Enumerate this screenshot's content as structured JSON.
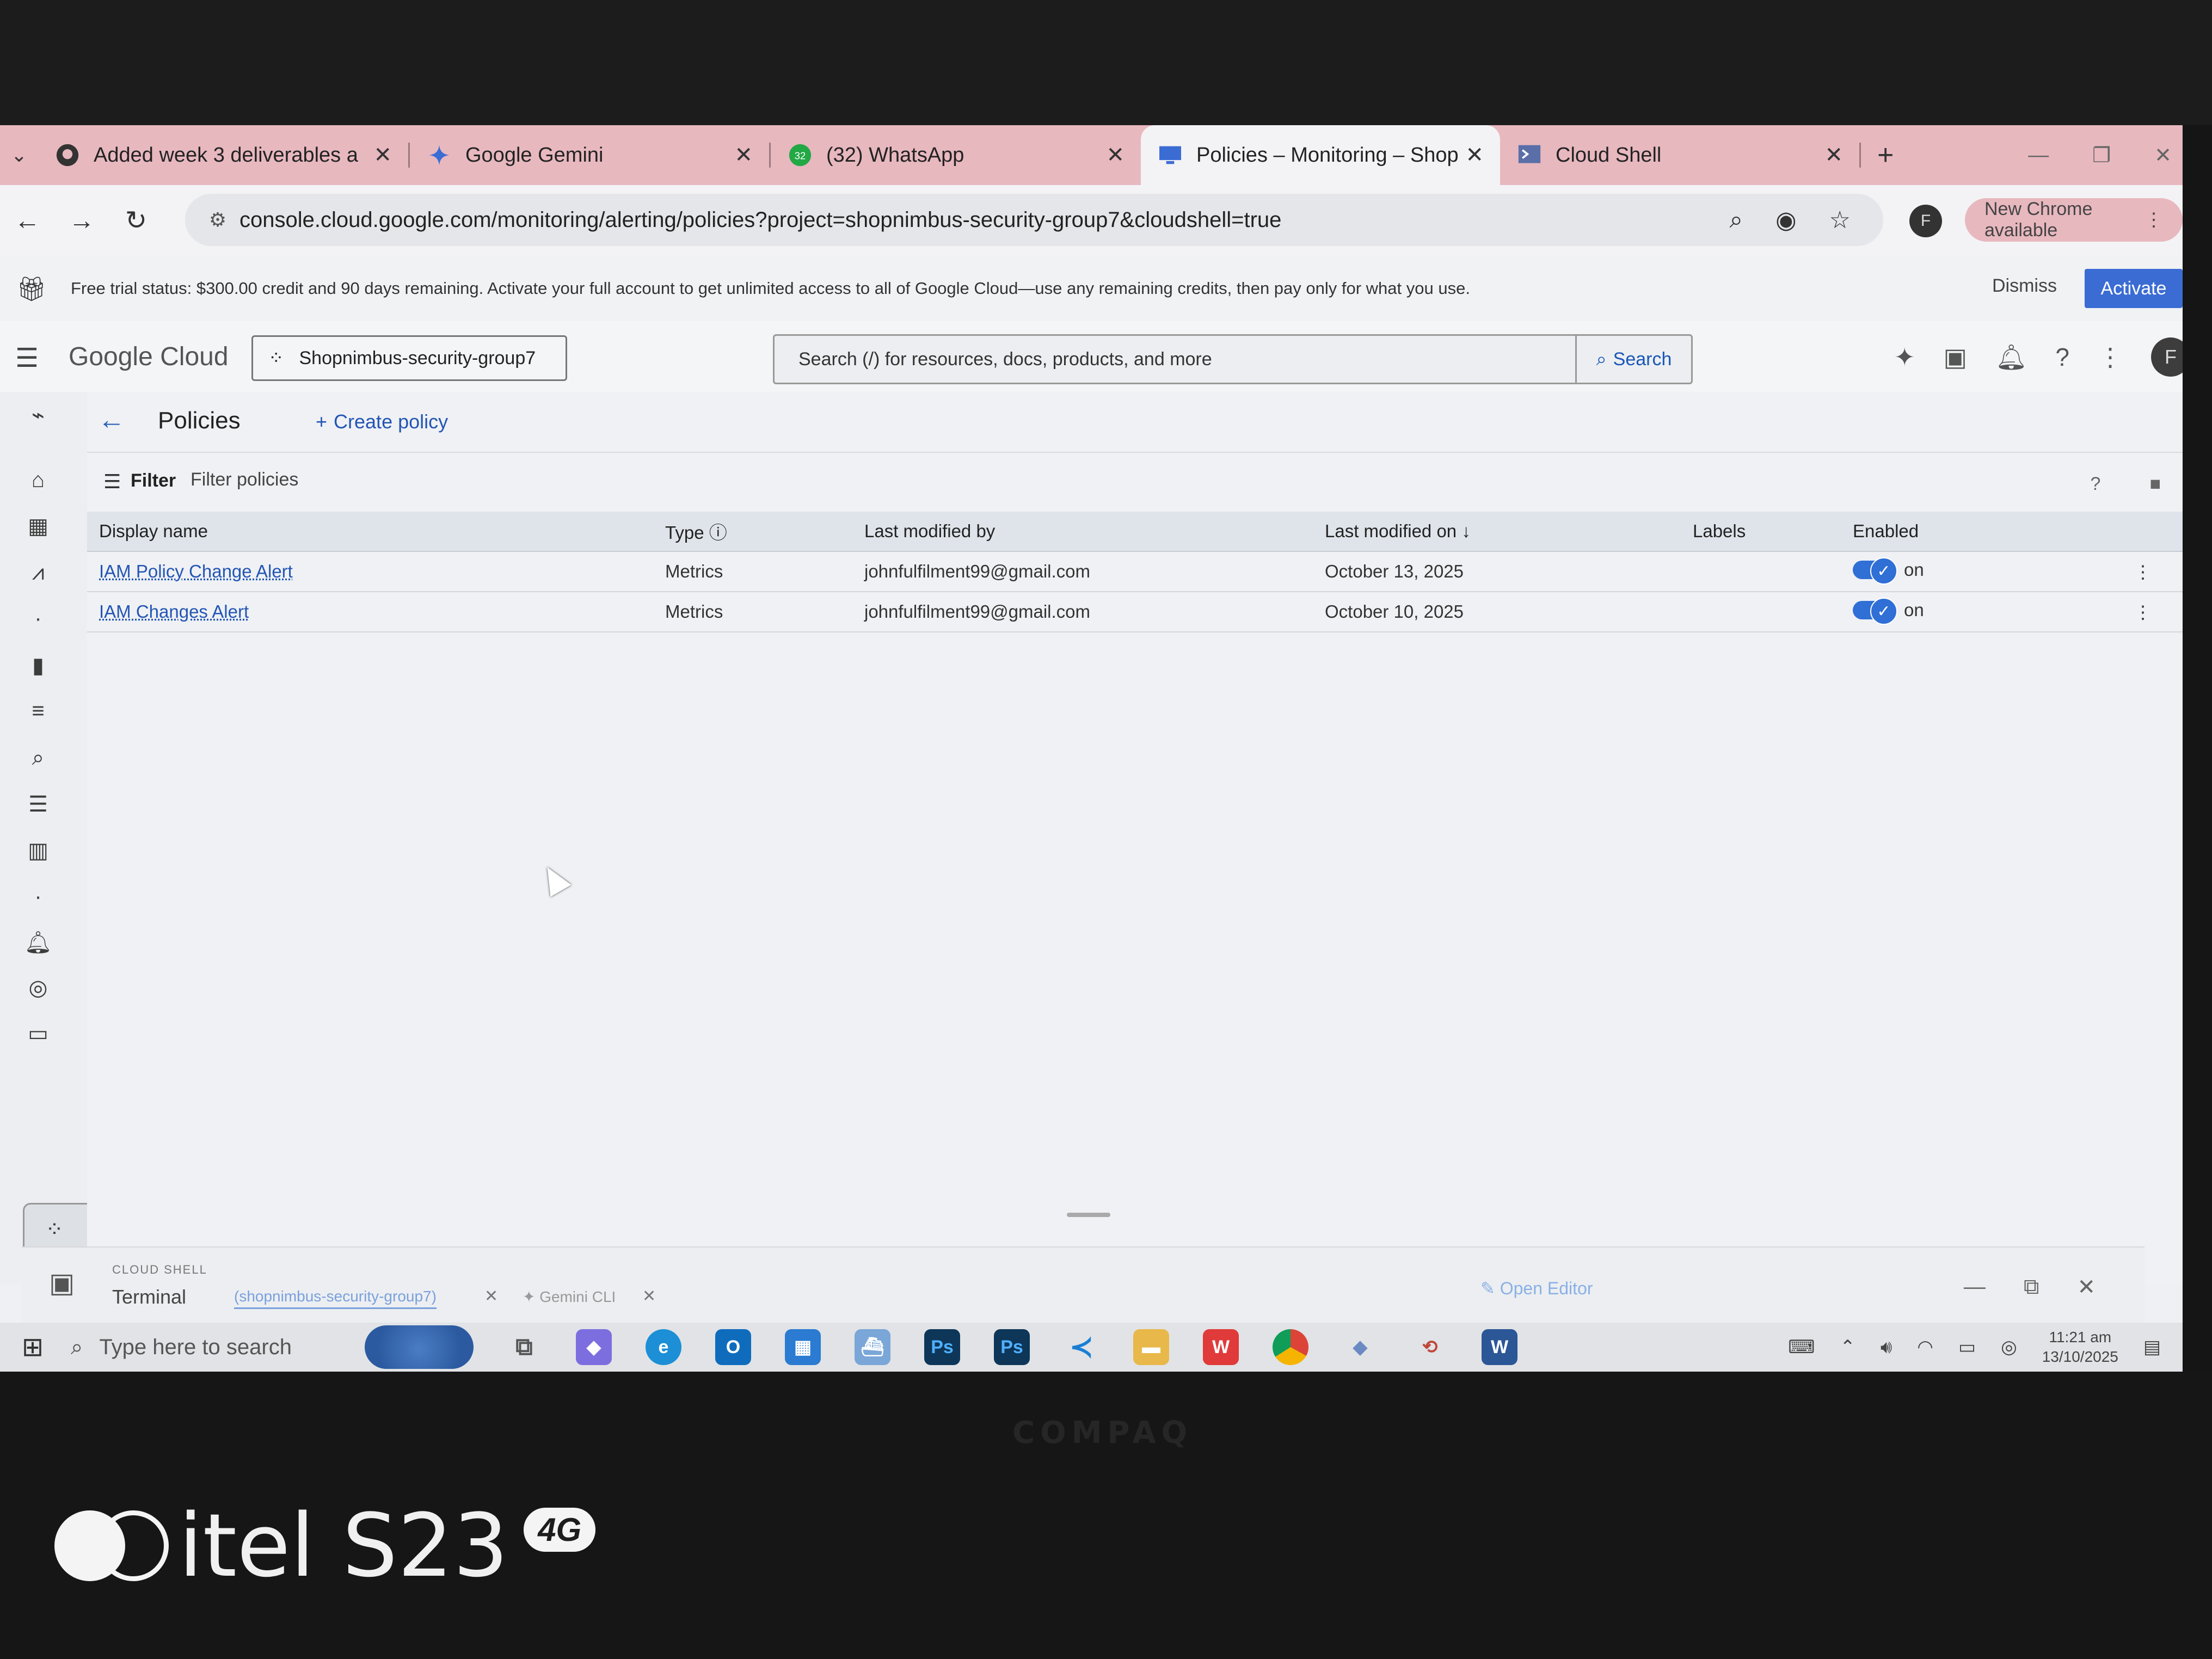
{
  "browser": {
    "tabs": [
      {
        "title": "Added week 3 deliverables a",
        "icon": "github-icon",
        "active": false
      },
      {
        "title": "Google Gemini",
        "icon": "gemini-icon",
        "active": false
      },
      {
        "title": "(32) WhatsApp",
        "icon": "whatsapp-icon",
        "active": false,
        "badge": "32"
      },
      {
        "title": "Policies – Monitoring – Shop",
        "icon": "monitoring-icon",
        "active": true
      },
      {
        "title": "Cloud Shell",
        "icon": "cloud-shell-icon",
        "active": false
      }
    ],
    "url": "console.cloud.google.com/monitoring/alerting/policies?project=shopnimbus-security-group7&cloudshell=true",
    "profile_initial": "F",
    "update_label": "New Chrome available"
  },
  "banner": {
    "text": "Free trial status: $300.00 credit and 90 days remaining. Activate your full account to get unlimited access to all of Google Cloud—use any remaining credits, then pay only for what you use.",
    "dismiss_label": "Dismiss",
    "activate_label": "Activate"
  },
  "header": {
    "logo_google": "Google",
    "logo_cloud": "Cloud",
    "project": "Shopnimbus-security-group7",
    "search_placeholder": "Search (/) for resources, docs, products, and more",
    "search_button": "Search",
    "avatar_initial": "F"
  },
  "page": {
    "title": "Policies",
    "create_label": "Create policy",
    "filter_label": "Filter",
    "filter_placeholder": "Filter policies"
  },
  "table": {
    "columns": [
      "Display name",
      "Type",
      "Last modified by",
      "Last modified on",
      "Labels",
      "Enabled"
    ],
    "rows": [
      {
        "name": "IAM Policy Change Alert",
        "type": "Metrics",
        "modified_by": "johnfulfilment99@gmail.com",
        "modified_on": "October 13, 2025",
        "labels": "",
        "enabled": "on"
      },
      {
        "name": "IAM Changes Alert",
        "type": "Metrics",
        "modified_by": "johnfulfilment99@gmail.com",
        "modified_on": "October 10, 2025",
        "labels": "",
        "enabled": "on"
      }
    ]
  },
  "shell": {
    "caption": "CLOUD SHELL",
    "terminal_label": "Terminal",
    "session_tab": "(shopnimbus-security-group7)",
    "gemini_tab": "Gemini CLI",
    "open_editor": "Open Editor"
  },
  "taskbar": {
    "search_placeholder": "Type here to search",
    "time": "11:21 am",
    "date": "13/10/2025"
  },
  "device": {
    "laptop_brand": "COMPAQ",
    "phone_watermark": "itel S23",
    "phone_badge": "4G"
  },
  "colors": {
    "tab_strip": "#e8b8bf",
    "accent_blue": "#3b6cd4",
    "link_blue": "#2355b5"
  }
}
